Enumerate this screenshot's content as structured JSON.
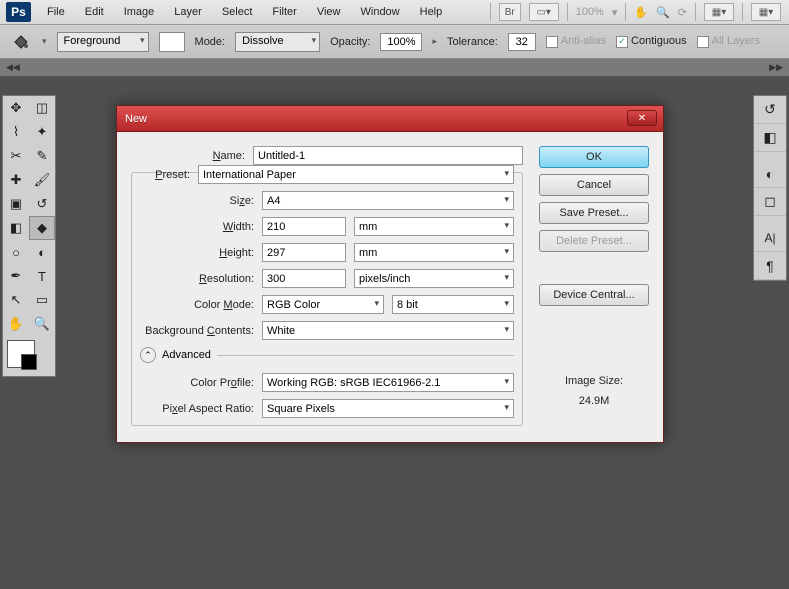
{
  "menu": {
    "items": [
      "File",
      "Edit",
      "Image",
      "Layer",
      "Select",
      "Filter",
      "View",
      "Window",
      "Help"
    ]
  },
  "menuRight": {
    "zoom": "100%"
  },
  "options": {
    "fg_label": "Foreground",
    "mode_label": "Mode:",
    "mode_value": "Dissolve",
    "opacity_label": "Opacity:",
    "opacity_value": "100%",
    "tolerance_label": "Tolerance:",
    "tolerance_value": "32",
    "antialias_label": "Anti-alias",
    "contiguous_label": "Contiguous",
    "all_layers_label": "All Layers"
  },
  "dialog": {
    "title": "New",
    "labels": {
      "name": "Name:",
      "preset": "Preset:",
      "size": "Size:",
      "width": "Width:",
      "height": "Height:",
      "resolution": "Resolution:",
      "color_mode": "Color Mode:",
      "bg_contents": "Background Contents:",
      "advanced": "Advanced",
      "color_profile": "Color Profile:",
      "pixel_aspect": "Pixel Aspect Ratio:",
      "image_size_lbl": "Image Size:"
    },
    "values": {
      "name": "Untitled-1",
      "preset": "International Paper",
      "size": "A4",
      "width": "210",
      "width_unit": "mm",
      "height": "297",
      "height_unit": "mm",
      "resolution": "300",
      "resolution_unit": "pixels/inch",
      "color_mode": "RGB Color",
      "bit_depth": "8 bit",
      "bg_contents": "White",
      "color_profile": "Working RGB:  sRGB IEC61966-2.1",
      "pixel_aspect": "Square Pixels",
      "image_size": "24.9M"
    },
    "buttons": {
      "ok": "OK",
      "cancel": "Cancel",
      "save_preset": "Save Preset...",
      "delete_preset": "Delete Preset...",
      "device_central": "Device Central..."
    }
  }
}
